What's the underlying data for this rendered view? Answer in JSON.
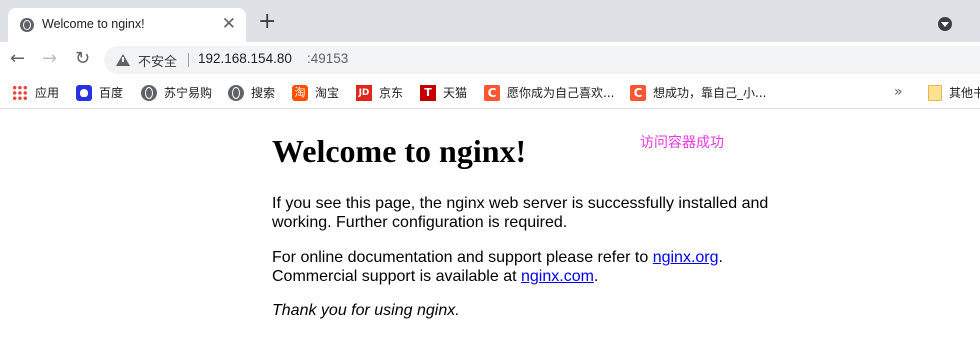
{
  "tab": {
    "title": "Welcome to nginx!",
    "close_glyph": "✕",
    "favicon": "globe-icon"
  },
  "new_tab_glyph": "+",
  "toolbar": {
    "back_glyph": "←",
    "forward_glyph": "→",
    "reload_glyph": "↻",
    "security_label": "不安全",
    "url_host": "192.168.154.80",
    "url_port": ":49153"
  },
  "bookmarks": [
    {
      "label": "应用",
      "icon": "apps-icon"
    },
    {
      "label": "百度",
      "icon": "baidu-icon"
    },
    {
      "label": "苏宁易购",
      "icon": "globe-icon"
    },
    {
      "label": "搜索",
      "icon": "globe-icon"
    },
    {
      "label": "淘宝",
      "icon": "taobao-icon"
    },
    {
      "label": "京东",
      "icon": "jd-icon"
    },
    {
      "label": "天猫",
      "icon": "tmall-icon"
    },
    {
      "label": "愿你成为自己喜欢...",
      "icon": "csdn-icon"
    },
    {
      "label": "想成功，靠自己_小...",
      "icon": "csdn-icon"
    }
  ],
  "bookmarks_more": "»",
  "other_bookmarks": "其他书",
  "icon_text": {
    "jd": "JD",
    "tmall": "T",
    "csdn": "C",
    "taobao": "淘"
  },
  "page": {
    "heading": "Welcome to nginx!",
    "annotation": "访问容器成功",
    "p1": "If you see this page, the nginx web server is successfully installed and working. Further configuration is required.",
    "p2_before": "For online documentation and support please refer to ",
    "p2_link": "nginx.org",
    "p2_mid": ".",
    "p2_line2": "Commercial support is available at ",
    "p2_link2": "nginx.com",
    "p2_end": ".",
    "p3": "Thank you for using nginx."
  },
  "colors": {
    "annotation": "#e83ae0",
    "link": "#0000ee",
    "tabstrip": "#dee1e6"
  }
}
